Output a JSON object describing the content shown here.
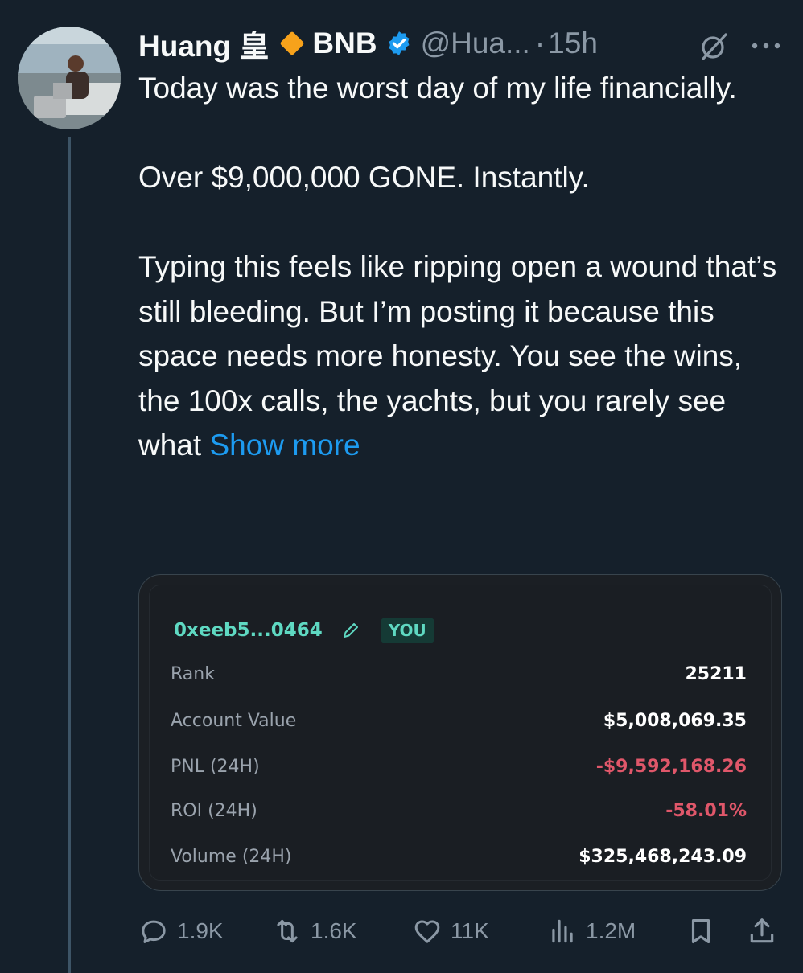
{
  "author": {
    "display_name": "Huang 皇",
    "name_suffix": "BNB",
    "handle": "@Hua...",
    "separator": "·",
    "time": "15h"
  },
  "tweet": {
    "paragraph1": "Today was the worst day of my life financially.",
    "paragraph2": "Over $9,000,000 GONE. Instantly.",
    "paragraph3": "Typing this feels like ripping open a wound that’s still bleeding. But I’m posting it because this space needs more honesty. You see the wins, the 100x calls, the yachts, but you rarely see what",
    "show_more": "Show more"
  },
  "card": {
    "address": "0xeeb5...0464",
    "badge": "YOU",
    "stats": [
      {
        "label": "Rank",
        "value": "25211"
      },
      {
        "label": "Account Value",
        "value": "$5,008,069.35"
      },
      {
        "label": "PNL (24H)",
        "value": "-$9,592,168.26"
      },
      {
        "label": "ROI (24H)",
        "value": "-58.01%"
      },
      {
        "label": "Volume (24H)",
        "value": "$325,468,243.09"
      }
    ],
    "accent_color": "#5fd9c2",
    "negative_color": "#e0576a"
  },
  "actions": {
    "replies": "1.9K",
    "reposts": "1.6K",
    "likes": "11K",
    "views": "1.2M"
  },
  "colors": {
    "background": "#15202b",
    "link": "#1d9bf0",
    "muted": "#8b98a5",
    "diamond": "#f7a21b"
  }
}
